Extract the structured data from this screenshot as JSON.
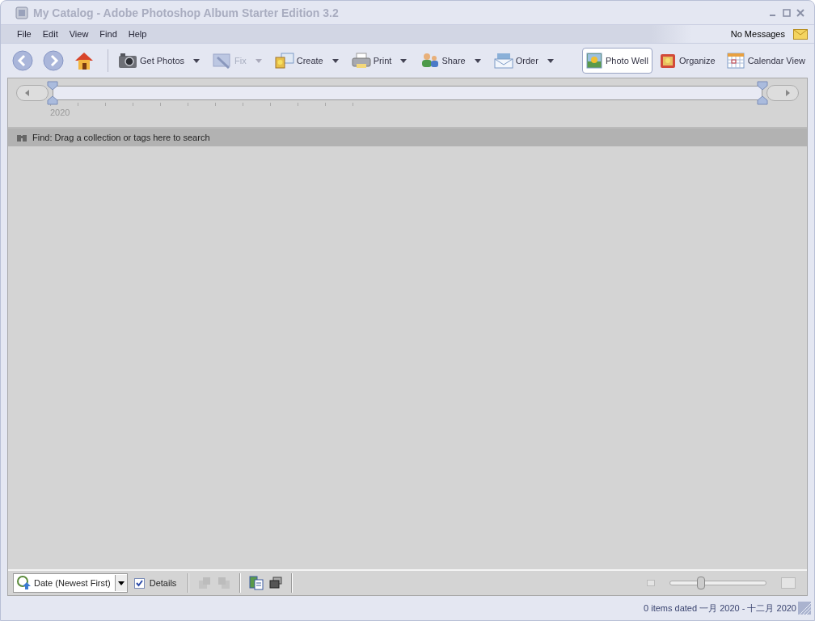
{
  "window": {
    "title": "My Catalog - Adobe Photoshop Album Starter Edition 3.2"
  },
  "menu": [
    "File",
    "Edit",
    "View",
    "Find",
    "Help"
  ],
  "messages": "No Messages",
  "toolbar": [
    {
      "label": "Get Photos",
      "kind": "camera",
      "disabled": false
    },
    {
      "label": "Fix",
      "kind": "fix",
      "disabled": true
    },
    {
      "label": "Create",
      "kind": "create",
      "disabled": false
    },
    {
      "label": "Print",
      "kind": "print",
      "disabled": false
    },
    {
      "label": "Share",
      "kind": "share",
      "disabled": false
    },
    {
      "label": "Order",
      "kind": "order",
      "disabled": false
    }
  ],
  "views": [
    {
      "label": "Photo Well",
      "kind": "well",
      "selected": true
    },
    {
      "label": "Organize",
      "kind": "organize",
      "selected": false
    },
    {
      "label": "Calendar View",
      "kind": "calendar",
      "selected": false
    }
  ],
  "timeline": {
    "year": "2020"
  },
  "find_bar": {
    "text": "Find: Drag a collection or tags here to search"
  },
  "bottom_bar": {
    "sort": "Date (Newest First)",
    "details": {
      "label": "Details",
      "checked": true
    },
    "zoom": {
      "level": 0.33
    }
  },
  "status_bar": "0 items dated 一月 2020 - 十二月 2020"
}
